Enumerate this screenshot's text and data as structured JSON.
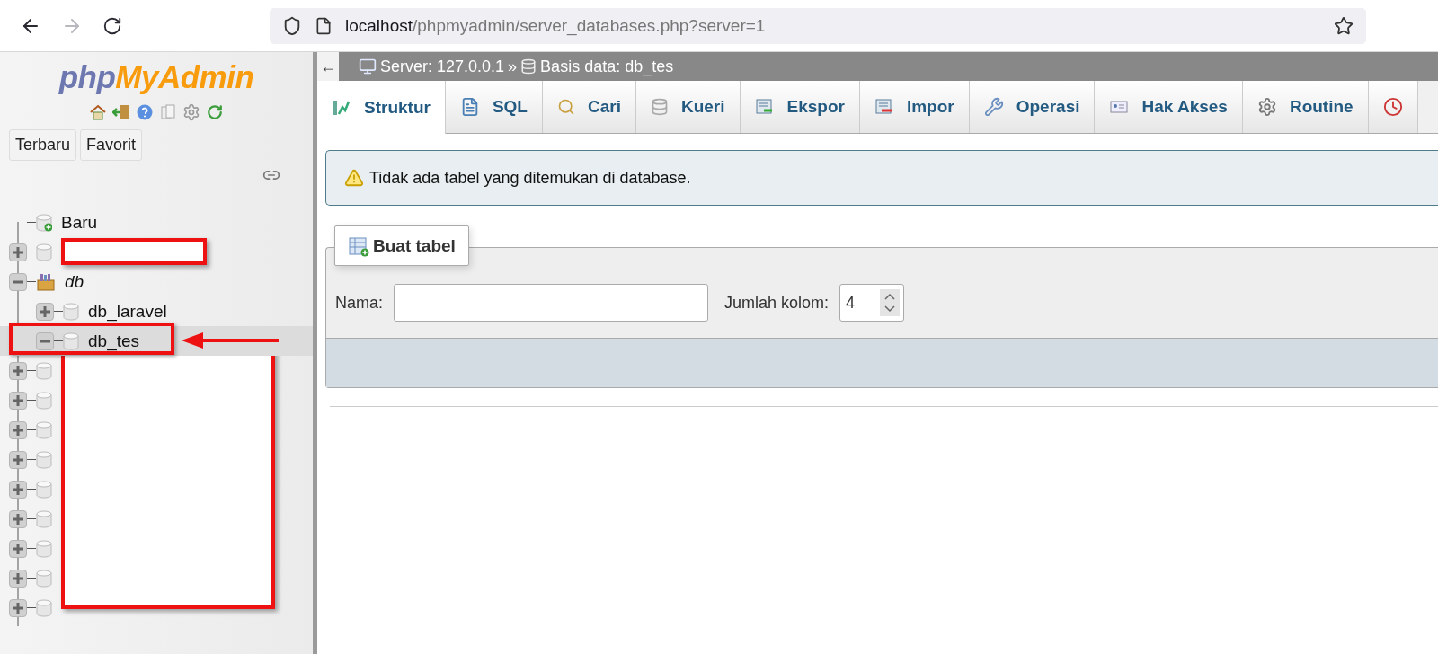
{
  "browser": {
    "url": {
      "host": "localhost",
      "path": "/phpmyadmin/server_databases.php?server=1"
    },
    "forward_disabled": true
  },
  "sidebar": {
    "logo": {
      "first": "php",
      "second": "MyAdmin"
    },
    "buttons": [
      "Terbaru",
      "Favorit"
    ],
    "tree": [
      {
        "kind": "new",
        "label": "Baru"
      },
      {
        "kind": "database",
        "redacted": true,
        "expanded": false
      },
      {
        "kind": "group",
        "label": "db",
        "expanded": true,
        "children": [
          {
            "kind": "database",
            "label": "db_laravel",
            "expanded": false,
            "selected": false,
            "marked": false
          },
          {
            "kind": "database",
            "label": "db_tes",
            "expanded": true,
            "selected": true,
            "marked": true
          }
        ]
      },
      {
        "kind": "database",
        "redacted": true,
        "expanded": false
      },
      {
        "kind": "database",
        "redacted": true,
        "expanded": false
      },
      {
        "kind": "database",
        "redacted": true,
        "expanded": false
      },
      {
        "kind": "database",
        "redacted": true,
        "expanded": false
      },
      {
        "kind": "database",
        "redacted": true,
        "expanded": false
      },
      {
        "kind": "database",
        "redacted": true,
        "expanded": false
      },
      {
        "kind": "database",
        "redacted": true,
        "expanded": false
      },
      {
        "kind": "database",
        "redacted": true,
        "expanded": false
      },
      {
        "kind": "database",
        "redacted": true,
        "expanded": false
      }
    ]
  },
  "breadcrumb": {
    "back": "←",
    "server": "Server: 127.0.0.1",
    "separator": "»",
    "database": "Basis data: db_tes"
  },
  "tabs": [
    {
      "kind": "structure",
      "label": "Struktur",
      "selected": true
    },
    {
      "kind": "sql",
      "label": "SQL",
      "selected": false
    },
    {
      "kind": "search",
      "label": "Cari",
      "selected": false
    },
    {
      "kind": "query",
      "label": "Kueri",
      "selected": false
    },
    {
      "kind": "export",
      "label": "Ekspor",
      "selected": false
    },
    {
      "kind": "import",
      "label": "Impor",
      "selected": false
    },
    {
      "kind": "operations",
      "label": "Operasi",
      "selected": false
    },
    {
      "kind": "privileges",
      "label": "Hak Akses",
      "selected": false
    },
    {
      "kind": "routines",
      "label": "Routine",
      "selected": false
    },
    {
      "kind": "events",
      "selected": false
    }
  ],
  "notice": "Tidak ada tabel yang ditemukan di database.",
  "create_table": {
    "legend": "Buat tabel",
    "name_label": "Nama:",
    "columns_label": "Jumlah kolom:",
    "columns_value": "4"
  }
}
